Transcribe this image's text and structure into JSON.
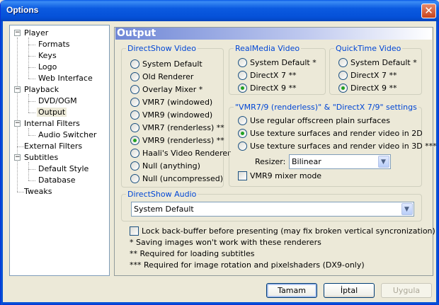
{
  "window": {
    "title": "Options"
  },
  "tree": {
    "items": [
      {
        "label": "Player",
        "level": 0,
        "expanded": true
      },
      {
        "label": "Formats",
        "level": 1
      },
      {
        "label": "Keys",
        "level": 1
      },
      {
        "label": "Logo",
        "level": 1
      },
      {
        "label": "Web Interface",
        "level": 1
      },
      {
        "label": "Playback",
        "level": 0,
        "expanded": true
      },
      {
        "label": "DVD/OGM",
        "level": 1
      },
      {
        "label": "Output",
        "level": 1,
        "selected": true
      },
      {
        "label": "Internal Filters",
        "level": 0,
        "expanded": true
      },
      {
        "label": "Audio Switcher",
        "level": 1
      },
      {
        "label": "External Filters",
        "level": 0
      },
      {
        "label": "Subtitles",
        "level": 0,
        "expanded": true
      },
      {
        "label": "Default Style",
        "level": 1
      },
      {
        "label": "Database",
        "level": 1
      },
      {
        "label": "Tweaks",
        "level": 0
      }
    ]
  },
  "page": {
    "title": "Output",
    "directshow_video": {
      "title": "DirectShow Video",
      "options": [
        {
          "label": "System Default",
          "checked": false
        },
        {
          "label": "Old Renderer",
          "checked": false
        },
        {
          "label": "Overlay Mixer *",
          "checked": false
        },
        {
          "label": "VMR7 (windowed)",
          "checked": false
        },
        {
          "label": "VMR9 (windowed)",
          "checked": false
        },
        {
          "label": "VMR7 (renderless) **",
          "checked": false
        },
        {
          "label": "VMR9 (renderless) **",
          "checked": true
        },
        {
          "label": "Haali's Video Renderer",
          "checked": false
        },
        {
          "label": "Null (anything)",
          "checked": false
        },
        {
          "label": "Null (uncompressed)",
          "checked": false
        }
      ]
    },
    "realmedia_video": {
      "title": "RealMedia Video",
      "options": [
        {
          "label": "System Default *",
          "checked": false
        },
        {
          "label": "DirectX 7 **",
          "checked": false
        },
        {
          "label": "DirectX 9 **",
          "checked": true
        }
      ]
    },
    "quicktime_video": {
      "title": "QuickTime Video",
      "options": [
        {
          "label": "System Default *",
          "checked": false
        },
        {
          "label": "DirectX 7 **",
          "checked": false
        },
        {
          "label": "DirectX 9 **",
          "checked": true
        }
      ]
    },
    "vmr_settings": {
      "title": "\"VMR7/9 (renderless)\" & \"DirectX 7/9\" settings",
      "options": [
        {
          "label": "Use regular offscreen plain surfaces",
          "checked": false
        },
        {
          "label": "Use texture surfaces and render video in 2D",
          "checked": true
        },
        {
          "label": "Use texture surfaces and render video in 3D ***",
          "checked": false
        }
      ],
      "resizer_label": "Resizer:",
      "resizer_value": "Bilinear",
      "mixer_label": "VMR9 mixer mode",
      "mixer_checked": false
    },
    "directshow_audio": {
      "title": "DirectShow Audio",
      "value": "System Default"
    },
    "lock_backbuffer": {
      "label": "Lock back-buffer before presenting (may fix broken vertical syncronization)",
      "checked": false
    },
    "notes": [
      "* Saving images won't work with these renderers",
      "** Required for loading subtitles",
      "*** Required for image rotation and pixelshaders (DX9-only)"
    ]
  },
  "buttons": {
    "ok": "Tamam",
    "cancel": "İptal",
    "apply": "Uygula"
  }
}
